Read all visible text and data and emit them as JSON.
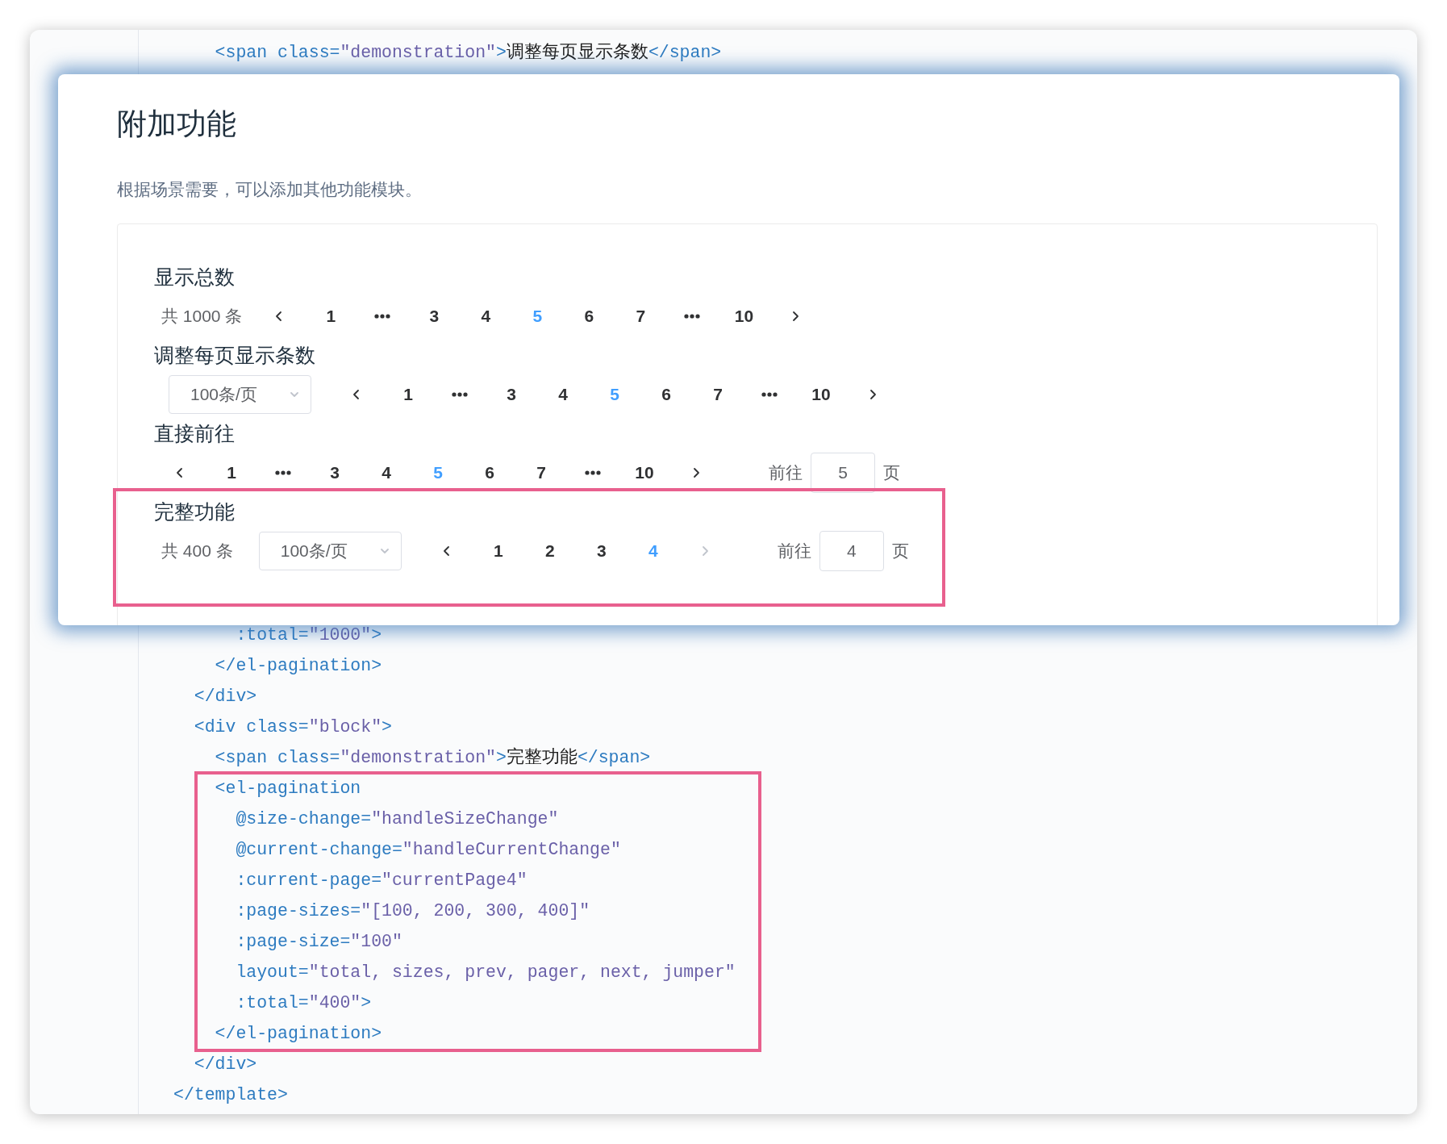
{
  "code_top": [
    [
      {
        "kind": "tag",
        "s": "    <span class="
      },
      {
        "kind": "str",
        "s": "\"demonstration\""
      },
      {
        "kind": "tag",
        "s": ">"
      },
      {
        "kind": "text",
        "s": "调整每页显示条数"
      },
      {
        "kind": "tag",
        "s": "</span>"
      }
    ]
  ],
  "panel": {
    "title": "附加功能",
    "description": "根据场景需要，可以添加其他功能模块。",
    "sections": [
      {
        "title": "显示总数",
        "items": [
          {
            "kind": "total",
            "label": "共 1000 条"
          },
          {
            "kind": "prev",
            "disabled": false
          },
          {
            "kind": "page",
            "label": "1",
            "selected": false
          },
          {
            "kind": "more"
          },
          {
            "kind": "page",
            "label": "3",
            "selected": false
          },
          {
            "kind": "page",
            "label": "4",
            "selected": false
          },
          {
            "kind": "page",
            "label": "5",
            "selected": true
          },
          {
            "kind": "page",
            "label": "6",
            "selected": false
          },
          {
            "kind": "page",
            "label": "7",
            "selected": false
          },
          {
            "kind": "more"
          },
          {
            "kind": "page",
            "label": "10",
            "selected": false
          },
          {
            "kind": "next",
            "disabled": false
          }
        ]
      },
      {
        "title": "调整每页显示条数",
        "items": [
          {
            "kind": "sizes",
            "value": "100条/页"
          },
          {
            "kind": "prev",
            "disabled": false
          },
          {
            "kind": "page",
            "label": "1",
            "selected": false
          },
          {
            "kind": "more"
          },
          {
            "kind": "page",
            "label": "3",
            "selected": false
          },
          {
            "kind": "page",
            "label": "4",
            "selected": false
          },
          {
            "kind": "page",
            "label": "5",
            "selected": true
          },
          {
            "kind": "page",
            "label": "6",
            "selected": false
          },
          {
            "kind": "page",
            "label": "7",
            "selected": false
          },
          {
            "kind": "more"
          },
          {
            "kind": "page",
            "label": "10",
            "selected": false
          },
          {
            "kind": "next",
            "disabled": false
          }
        ]
      },
      {
        "title": "直接前往",
        "items": [
          {
            "kind": "prev",
            "disabled": false
          },
          {
            "kind": "page",
            "label": "1",
            "selected": false
          },
          {
            "kind": "more"
          },
          {
            "kind": "page",
            "label": "3",
            "selected": false
          },
          {
            "kind": "page",
            "label": "4",
            "selected": false
          },
          {
            "kind": "page",
            "label": "5",
            "selected": true
          },
          {
            "kind": "page",
            "label": "6",
            "selected": false
          },
          {
            "kind": "page",
            "label": "7",
            "selected": false
          },
          {
            "kind": "more"
          },
          {
            "kind": "page",
            "label": "10",
            "selected": false
          },
          {
            "kind": "next",
            "disabled": false
          },
          {
            "kind": "jumper",
            "before": "前往",
            "value": "5",
            "after": "页"
          }
        ]
      }
    ],
    "highlighted_section": {
      "title": "完整功能",
      "items": [
        {
          "kind": "total",
          "label": "共 400 条"
        },
        {
          "kind": "sizes",
          "value": "100条/页"
        },
        {
          "kind": "prev",
          "disabled": false
        },
        {
          "kind": "page",
          "label": "1",
          "selected": false
        },
        {
          "kind": "page",
          "label": "2",
          "selected": false
        },
        {
          "kind": "page",
          "label": "3",
          "selected": false
        },
        {
          "kind": "page",
          "label": "4",
          "selected": true
        },
        {
          "kind": "next",
          "disabled": true
        },
        {
          "kind": "jumper",
          "before": "前往",
          "value": "4",
          "after": "页"
        }
      ]
    }
  },
  "code_bottom": {
    "lines": [
      [
        {
          "kind": "tag",
          "s": "      :total="
        },
        {
          "kind": "str",
          "s": "\"1000\""
        },
        {
          "kind": "tag",
          "s": ">"
        }
      ],
      [
        {
          "kind": "tag",
          "s": "    </el-pagination>"
        }
      ],
      [
        {
          "kind": "tag",
          "s": "  </div>"
        }
      ],
      [
        {
          "kind": "tag",
          "s": "  <div class="
        },
        {
          "kind": "str",
          "s": "\"block\""
        },
        {
          "kind": "tag",
          "s": ">"
        }
      ],
      [
        {
          "kind": "tag",
          "s": "    <span class="
        },
        {
          "kind": "str",
          "s": "\"demonstration\""
        },
        {
          "kind": "tag",
          "s": ">"
        },
        {
          "kind": "text",
          "s": "完整功能"
        },
        {
          "kind": "tag",
          "s": "</span>"
        }
      ]
    ],
    "highlighted_lines": [
      [
        {
          "kind": "tag",
          "s": "    <el-pagination"
        }
      ],
      [
        {
          "kind": "tag",
          "s": "      @size-change="
        },
        {
          "kind": "str",
          "s": "\"handleSizeChange\""
        }
      ],
      [
        {
          "kind": "tag",
          "s": "      @current-change="
        },
        {
          "kind": "str",
          "s": "\"handleCurrentChange\""
        }
      ],
      [
        {
          "kind": "tag",
          "s": "      :current-page="
        },
        {
          "kind": "str",
          "s": "\"currentPage4\""
        }
      ],
      [
        {
          "kind": "tag",
          "s": "      :page-sizes="
        },
        {
          "kind": "str",
          "s": "\"[100, 200, 300, 400]\""
        }
      ],
      [
        {
          "kind": "tag",
          "s": "      :page-size="
        },
        {
          "kind": "str",
          "s": "\"100\""
        }
      ],
      [
        {
          "kind": "tag",
          "s": "      layout="
        },
        {
          "kind": "str",
          "s": "\"total, sizes, prev, pager, next, jumper\""
        }
      ],
      [
        {
          "kind": "tag",
          "s": "      :total="
        },
        {
          "kind": "str",
          "s": "\"400\""
        },
        {
          "kind": "tag",
          "s": ">"
        }
      ],
      [
        {
          "kind": "tag",
          "s": "    </el-pagination>"
        }
      ]
    ],
    "lines_after": [
      [
        {
          "kind": "tag",
          "s": "  </div>"
        }
      ],
      [
        {
          "kind": "tag",
          "s": "</template>"
        }
      ]
    ]
  }
}
